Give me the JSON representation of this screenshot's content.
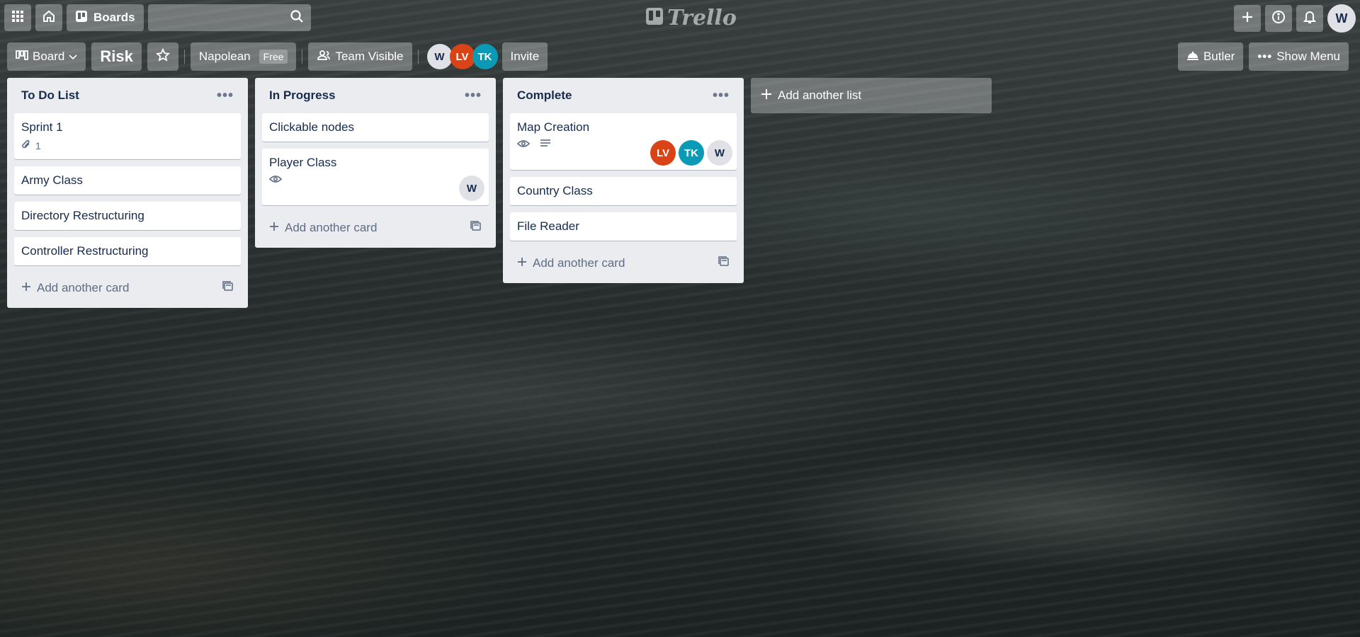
{
  "header": {
    "boards_label": "Boards",
    "search_value": "",
    "logo_text": "Trello",
    "user_initial": "W"
  },
  "boardbar": {
    "view_label": "Board",
    "board_title": "Risk",
    "team_name": "Napolean",
    "team_plan": "Free",
    "visibility": "Team Visible",
    "members": [
      {
        "initials": "W",
        "color": "#dfe1e6",
        "text_color": "#172b4d"
      },
      {
        "initials": "LV",
        "color": "#d94315",
        "text_color": "#ffffff"
      },
      {
        "initials": "TK",
        "color": "#0a9ab5",
        "text_color": "#ffffff"
      }
    ],
    "invite_label": "Invite",
    "butler_label": "Butler",
    "show_menu_label": "Show Menu"
  },
  "lists": [
    {
      "title": "To Do List",
      "cards": [
        {
          "title": "Sprint 1",
          "attachments": "1"
        },
        {
          "title": "Army Class"
        },
        {
          "title": "Directory Restructuring"
        },
        {
          "title": "Controller Restructuring"
        }
      ],
      "add_card_label": "Add another card"
    },
    {
      "title": "In Progress",
      "cards": [
        {
          "title": "Clickable nodes"
        },
        {
          "title": "Player Class",
          "member": "W"
        }
      ],
      "add_card_label": "Add another card"
    },
    {
      "title": "Complete",
      "cards": [
        {
          "title": "Map Creation",
          "members": [
            "LV",
            "TK",
            "W"
          ]
        },
        {
          "title": "Country Class"
        },
        {
          "title": "File Reader"
        }
      ],
      "add_card_label": "Add another card"
    }
  ],
  "add_list_label": "Add another list",
  "colors": {
    "list_bg": "#ebecf0",
    "lv": "#d94315",
    "tk": "#0a9ab5",
    "w": "#dfe1e6"
  }
}
